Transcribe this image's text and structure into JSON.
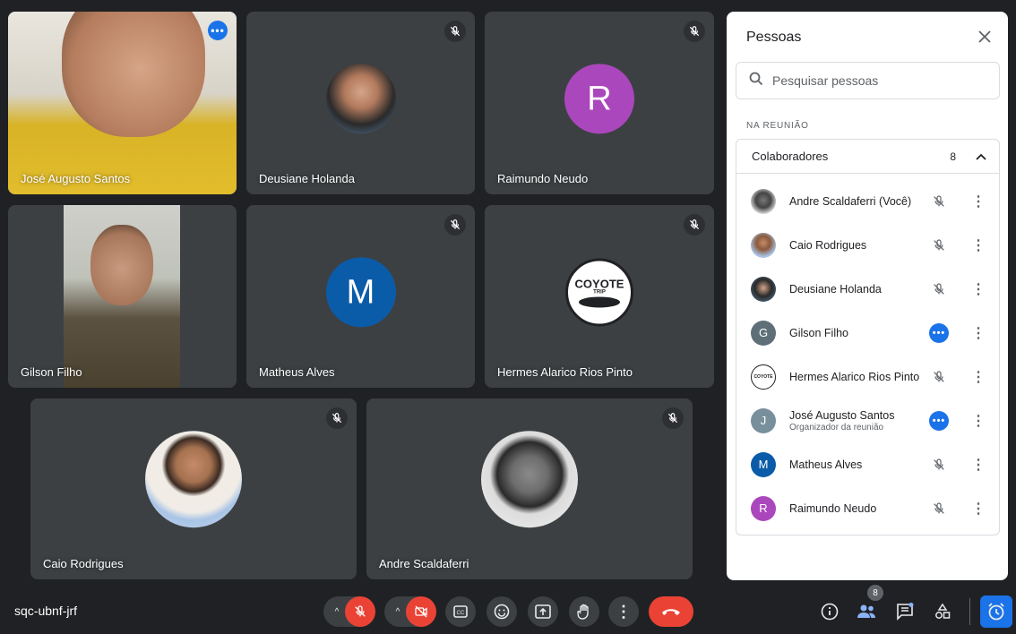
{
  "tiles": [
    {
      "name": "José Augusto Santos",
      "kind": "video"
    },
    {
      "name": "Deusiane Holanda",
      "kind": "photo"
    },
    {
      "name": "Raimundo Neudo",
      "kind": "letter",
      "initial": "R",
      "color": "#ab47bc"
    },
    {
      "name": "Gilson Filho",
      "kind": "video"
    },
    {
      "name": "Matheus Alves",
      "kind": "letter",
      "initial": "M",
      "color": "#0b5ca8"
    },
    {
      "name": "Hermes Alarico Rios Pinto",
      "kind": "logo",
      "logo_text": "COYOTE",
      "logo_sub": "TRIP"
    },
    {
      "name": "Caio Rodrigues",
      "kind": "photo"
    },
    {
      "name": "Andre Scaldaferri",
      "kind": "photo"
    }
  ],
  "panel": {
    "title": "Pessoas",
    "search_placeholder": "Pesquisar pessoas",
    "section_label": "NA REUNIÃO",
    "group_label": "Colaboradores",
    "group_count": "8",
    "people": [
      {
        "name": "Andre Scaldaferri (Você)",
        "status": "muted",
        "avatar": "photo"
      },
      {
        "name": "Caio Rodrigues",
        "status": "muted",
        "avatar": "photo"
      },
      {
        "name": "Deusiane Holanda",
        "status": "muted",
        "avatar": "photo"
      },
      {
        "name": "Gilson Filho",
        "status": "more",
        "avatar": "letter",
        "initial": "G",
        "color": "#5f6f78"
      },
      {
        "name": "Hermes Alarico Rios Pinto",
        "status": "muted",
        "avatar": "logo"
      },
      {
        "name": "José Augusto Santos",
        "sub": "Organizador da reunião",
        "status": "more",
        "avatar": "letter",
        "initial": "J",
        "color": "#78909c"
      },
      {
        "name": "Matheus Alves",
        "status": "muted",
        "avatar": "letter",
        "initial": "M",
        "color": "#0b5ca8"
      },
      {
        "name": "Raimundo Neudo",
        "status": "muted",
        "avatar": "letter",
        "initial": "R",
        "color": "#ab47bc"
      }
    ]
  },
  "bottom": {
    "meeting_code": "sqc-ubnf-jrf",
    "participants_badge": "8"
  }
}
